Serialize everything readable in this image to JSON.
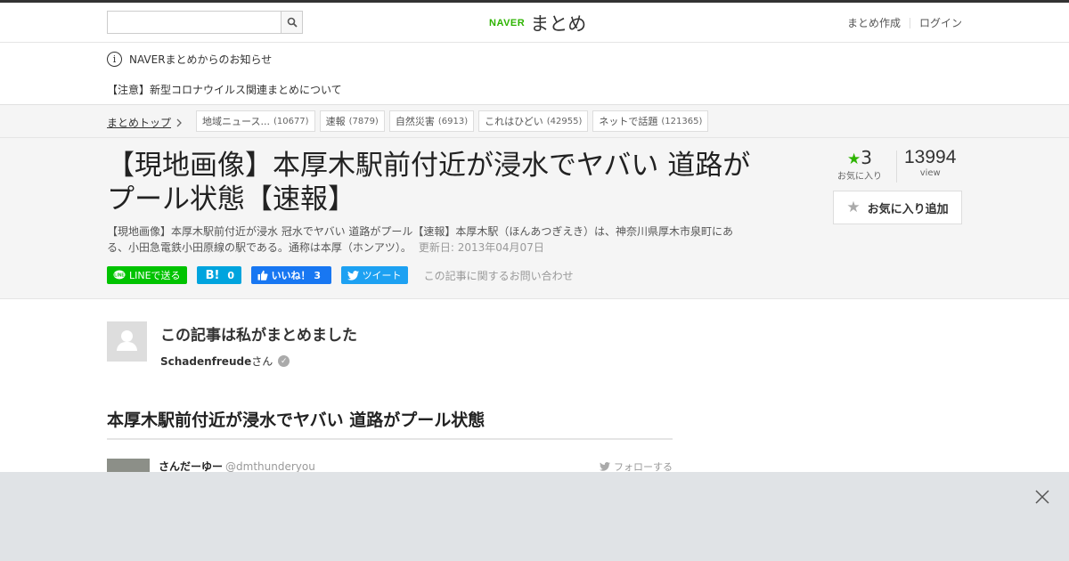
{
  "header": {
    "search_placeholder": "",
    "logo_naver": "NAVER",
    "logo_matome": "まとめ",
    "nav": [
      "まとめ作成",
      "ログイン"
    ]
  },
  "notice": {
    "label": "NAVERまとめからのお知らせ",
    "message": "【注意】新型コロナウイルス関連まとめについて"
  },
  "breadcrumb": {
    "top": "まとめトップ",
    "tags": [
      {
        "label": "地域ニュース...",
        "count": "(10677)"
      },
      {
        "label": "速報",
        "count": "(7879)"
      },
      {
        "label": "自然災害",
        "count": "(6913)"
      },
      {
        "label": "これはひどい",
        "count": "(42955)"
      },
      {
        "label": "ネットで話題",
        "count": "(121365)"
      }
    ]
  },
  "article": {
    "title": "【現地画像】本厚木駅前付近が浸水でヤバい 道路がプール状態【速報】",
    "description": "【現地画像】本厚木駅前付近が浸水 冠水でヤバい 道路がプール【速報】本厚木駅（ほんあつぎえき）は、神奈川県厚木市泉町にある、小田急電鉄小田原線の駅である。通称は本厚（ホンアツ）。",
    "updated": "更新日: 2013年04月07日",
    "share": {
      "line": "LINEで送る",
      "hatena_count": "0",
      "facebook": "いいね！ 3",
      "twitter": "ツイート",
      "contact": "この記事に関するお問い合わせ"
    },
    "favorites_count": "3",
    "favorites_label": "お気に入り",
    "views_count": "13994",
    "views_label": "view",
    "fav_button": "お気に入り追加"
  },
  "author": {
    "heading": "この記事は私がまとめました",
    "name": "Schadenfreude",
    "suffix": "さん"
  },
  "section": {
    "heading": "本厚木駅前付近が浸水でヤバい 道路がプール状態"
  },
  "tweet": {
    "name": "さんだーゆー",
    "handle": "@dmthunderyou",
    "follow": "フォローする"
  },
  "colors": {
    "accent_green": "#2db400",
    "line_green": "#00c300",
    "hatena_blue": "#00a4de",
    "facebook_blue": "#1877f2",
    "twitter_blue": "#1da1f2"
  }
}
